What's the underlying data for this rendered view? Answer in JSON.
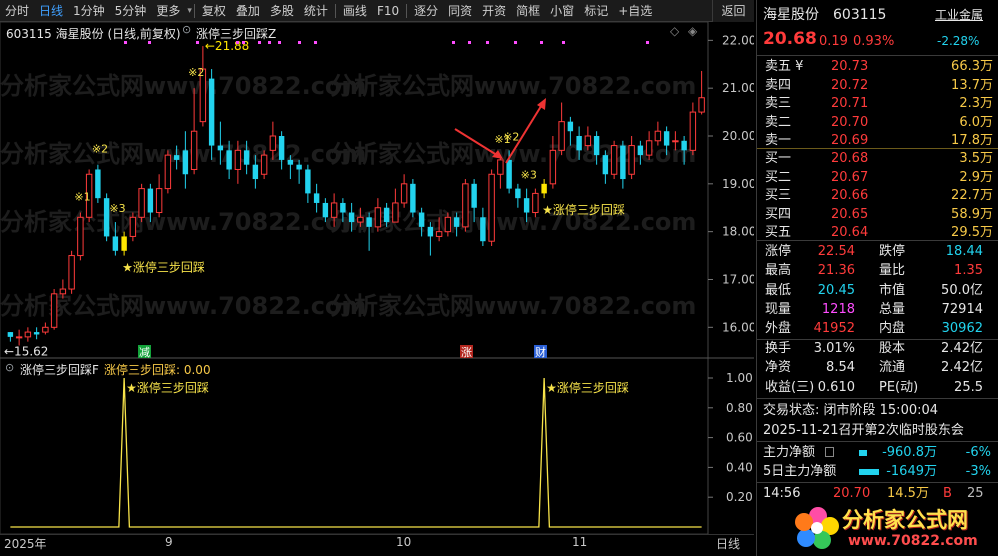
{
  "toolbar": {
    "items": [
      "分时",
      "日线",
      "1分钟",
      "5分钟",
      "更多",
      "复权",
      "叠加",
      "多股",
      "统计",
      "画线",
      "F10",
      "逐分",
      "同资",
      "开资",
      "简框",
      "小窗",
      "标记",
      "+自选"
    ],
    "active": "日线",
    "back": "返回"
  },
  "main_chart": {
    "title_code": "603115 海星股份 (日线,前复权)",
    "formula": "涨停三步回踩Z",
    "price_axis": [
      "22.00",
      "21.00",
      "20.00",
      "19.00",
      "18.00",
      "17.00",
      "16.00"
    ],
    "high_label": "21.88",
    "low_label": "15.62",
    "tags": [
      "※1",
      "※2",
      "※3",
      "※2",
      "※1",
      "※2",
      "※3"
    ],
    "signal_labels": [
      "★涨停三步回踩",
      "★涨停三步回踩"
    ],
    "badges": [
      "减",
      "涨",
      "财"
    ],
    "watermark": "分析家公式网www.70822.com"
  },
  "indicator": {
    "title": "涨停三步回踩F",
    "value_text": "涨停三步回踩: 0.00",
    "axis": [
      "1.00",
      "0.80",
      "0.60",
      "0.40",
      "0.20"
    ],
    "signal_labels": [
      "★涨停三步回踩",
      "★涨停三步回踩"
    ]
  },
  "xaxis": {
    "labels": [
      "2025年",
      "9",
      "10",
      "11"
    ],
    "period": "日线"
  },
  "colors": {
    "up": "#ff3b3b",
    "down": "#22d3ee",
    "highlight": "#ffe600",
    "signal": "#f7e34a",
    "background": "#000000"
  },
  "chart_data": {
    "type": "candlestick",
    "ylim": [
      15.4,
      22.3
    ],
    "candles": [
      [
        15.9,
        15.8,
        15.9,
        15.7
      ],
      [
        15.8,
        15.8,
        15.95,
        15.62
      ],
      [
        15.8,
        15.9,
        16.0,
        15.7
      ],
      [
        15.9,
        15.85,
        16.0,
        15.75
      ],
      [
        15.9,
        16.0,
        16.1,
        15.85
      ],
      [
        16.0,
        16.7,
        16.8,
        15.95
      ],
      [
        16.7,
        16.8,
        17.0,
        16.6
      ],
      [
        16.8,
        17.5,
        17.6,
        16.7
      ],
      [
        17.5,
        18.3,
        18.4,
        17.4
      ],
      [
        18.3,
        19.2,
        19.3,
        18.2
      ],
      [
        19.3,
        18.7,
        19.4,
        18.6
      ],
      [
        18.7,
        17.9,
        18.8,
        17.8
      ],
      [
        17.9,
        17.6,
        18.2,
        17.5
      ],
      [
        17.6,
        17.9,
        18.0,
        17.5
      ],
      [
        17.9,
        18.3,
        18.4,
        17.8
      ],
      [
        18.3,
        18.9,
        19.0,
        18.2
      ],
      [
        18.9,
        18.4,
        19.0,
        18.2
      ],
      [
        18.4,
        18.9,
        19.2,
        18.3
      ],
      [
        18.9,
        19.6,
        19.7,
        18.8
      ],
      [
        19.6,
        19.5,
        19.8,
        19.3
      ],
      [
        19.7,
        19.2,
        20.1,
        18.9
      ],
      [
        19.3,
        20.1,
        21.0,
        19.2
      ],
      [
        20.3,
        21.4,
        21.88,
        20.2
      ],
      [
        21.2,
        19.8,
        21.4,
        19.5
      ],
      [
        19.8,
        19.7,
        20.3,
        19.4
      ],
      [
        19.7,
        19.3,
        19.9,
        19.1
      ],
      [
        19.3,
        19.7,
        19.9,
        19.0
      ],
      [
        19.7,
        19.4,
        19.9,
        19.2
      ],
      [
        19.4,
        19.1,
        19.6,
        18.9
      ],
      [
        19.2,
        19.6,
        19.7,
        19.1
      ],
      [
        19.7,
        20.0,
        20.3,
        19.5
      ],
      [
        20.0,
        19.5,
        20.1,
        19.3
      ],
      [
        19.5,
        19.4,
        19.6,
        19.1
      ],
      [
        19.4,
        19.3,
        19.5,
        19.0
      ],
      [
        19.3,
        18.8,
        19.4,
        18.6
      ],
      [
        18.8,
        18.6,
        19.0,
        18.4
      ],
      [
        18.6,
        18.3,
        18.7,
        18.2
      ],
      [
        18.3,
        18.6,
        18.8,
        18.1
      ],
      [
        18.6,
        18.4,
        18.7,
        18.2
      ],
      [
        18.4,
        18.2,
        18.6,
        18.0
      ],
      [
        18.2,
        18.3,
        18.5,
        18.1
      ],
      [
        18.3,
        18.1,
        18.4,
        17.6
      ],
      [
        18.1,
        18.5,
        18.7,
        18.0
      ],
      [
        18.5,
        18.2,
        18.6,
        18.1
      ],
      [
        18.2,
        18.6,
        18.9,
        18.2
      ],
      [
        18.6,
        19.0,
        19.2,
        18.5
      ],
      [
        19.0,
        18.4,
        19.1,
        18.3
      ],
      [
        18.4,
        18.1,
        18.5,
        17.9
      ],
      [
        18.1,
        17.9,
        18.2,
        17.5
      ],
      [
        17.9,
        18.0,
        18.3,
        17.8
      ],
      [
        18.0,
        18.3,
        18.4,
        17.9
      ],
      [
        18.3,
        18.1,
        18.4,
        17.9
      ],
      [
        18.1,
        19.0,
        19.1,
        18.0
      ],
      [
        19.0,
        18.5,
        19.1,
        18.2
      ],
      [
        18.3,
        17.8,
        18.5,
        17.7
      ],
      [
        17.8,
        19.2,
        19.3,
        17.7
      ],
      [
        19.2,
        19.5,
        19.6,
        18.9
      ],
      [
        19.5,
        18.9,
        19.7,
        18.8
      ],
      [
        18.9,
        18.7,
        19.0,
        18.5
      ],
      [
        18.7,
        18.4,
        18.9,
        18.2
      ],
      [
        18.4,
        18.8,
        18.9,
        18.3
      ],
      [
        18.8,
        19.0,
        19.1,
        18.7
      ],
      [
        19.0,
        19.7,
        20.0,
        18.9
      ],
      [
        19.7,
        20.3,
        20.7,
        19.6
      ],
      [
        20.3,
        20.1,
        20.4,
        19.8
      ],
      [
        20.0,
        19.7,
        20.2,
        19.5
      ],
      [
        19.8,
        20.0,
        20.2,
        19.7
      ],
      [
        20.0,
        19.6,
        20.1,
        19.4
      ],
      [
        19.6,
        19.2,
        19.7,
        19.0
      ],
      [
        19.2,
        19.8,
        19.9,
        19.1
      ],
      [
        19.8,
        19.1,
        19.9,
        18.9
      ],
      [
        19.2,
        19.8,
        20.0,
        19.1
      ],
      [
        19.8,
        19.6,
        19.9,
        19.4
      ],
      [
        19.6,
        19.9,
        20.1,
        19.5
      ],
      [
        19.9,
        20.1,
        20.3,
        19.8
      ],
      [
        20.1,
        19.8,
        20.2,
        19.6
      ],
      [
        19.9,
        19.9,
        20.1,
        19.7
      ],
      [
        19.9,
        19.7,
        20.0,
        19.4
      ],
      [
        19.7,
        20.5,
        20.7,
        19.6
      ],
      [
        20.5,
        20.8,
        21.36,
        20.45
      ]
    ],
    "highlight_index": [
      13,
      61
    ],
    "signal_index": [
      13,
      61
    ]
  },
  "quote": {
    "name": "海星股份",
    "code": "603115",
    "industry": "工业金属",
    "price": "20.68",
    "change": "0.19",
    "pct": "0.93%",
    "industry_pct": "-2.28%",
    "asks": [
      {
        "label": "卖五 ¥",
        "price": "20.73",
        "vol": "66.3万"
      },
      {
        "label": "卖四",
        "price": "20.72",
        "vol": "13.7万"
      },
      {
        "label": "卖三",
        "price": "20.71",
        "vol": "2.3万"
      },
      {
        "label": "卖二",
        "price": "20.70",
        "vol": "6.0万"
      },
      {
        "label": "卖一",
        "price": "20.69",
        "vol": "17.8万"
      }
    ],
    "bids": [
      {
        "label": "买一",
        "price": "20.68",
        "vol": "3.5万"
      },
      {
        "label": "买二",
        "price": "20.67",
        "vol": "2.9万"
      },
      {
        "label": "买三",
        "price": "20.66",
        "vol": "22.7万"
      },
      {
        "label": "买四",
        "price": "20.65",
        "vol": "58.9万"
      },
      {
        "label": "买五",
        "price": "20.64",
        "vol": "29.5万"
      }
    ],
    "stats1": [
      {
        "k1": "涨停",
        "v1": "22.54",
        "k2": "跌停",
        "v2": "18.44"
      },
      {
        "k1": "最高",
        "v1": "21.36",
        "k2": "量比",
        "v2": "1.35"
      },
      {
        "k1": "最低",
        "v1": "20.45",
        "k2": "市值",
        "v2": "50.0亿"
      },
      {
        "k1": "现量",
        "v1": "1218",
        "k2": "总量",
        "v2": "72914"
      },
      {
        "k1": "外盘",
        "v1": "41952",
        "k2": "内盘",
        "v2": "30962"
      }
    ],
    "stats2": [
      {
        "k1": "换手",
        "v1": "3.01%",
        "k2": "股本",
        "v2": "2.42亿"
      },
      {
        "k1": "净资",
        "v1": "8.54",
        "k2": "流通",
        "v2": "2.42亿"
      },
      {
        "k1": "收益(三)",
        "v1": "0.610",
        "k2": "PE(动)",
        "v2": "25.5"
      }
    ],
    "status": "交易状态: 闭市阶段 15:00:04",
    "notice": "2025-11-21召开第2次临时股东会",
    "flows": [
      {
        "label": "主力净额",
        "value": "-960.8万",
        "pct": "-6%"
      },
      {
        "label": "5日主力净额",
        "value": "-1649万",
        "pct": "-3%"
      }
    ],
    "ticks": [
      {
        "time": "14:56",
        "price": "20.70",
        "vol": "14.5万",
        "side": "B",
        "n": "25"
      }
    ]
  },
  "logo": {
    "text": "分析家公式网",
    "url": "www.70822.com"
  }
}
